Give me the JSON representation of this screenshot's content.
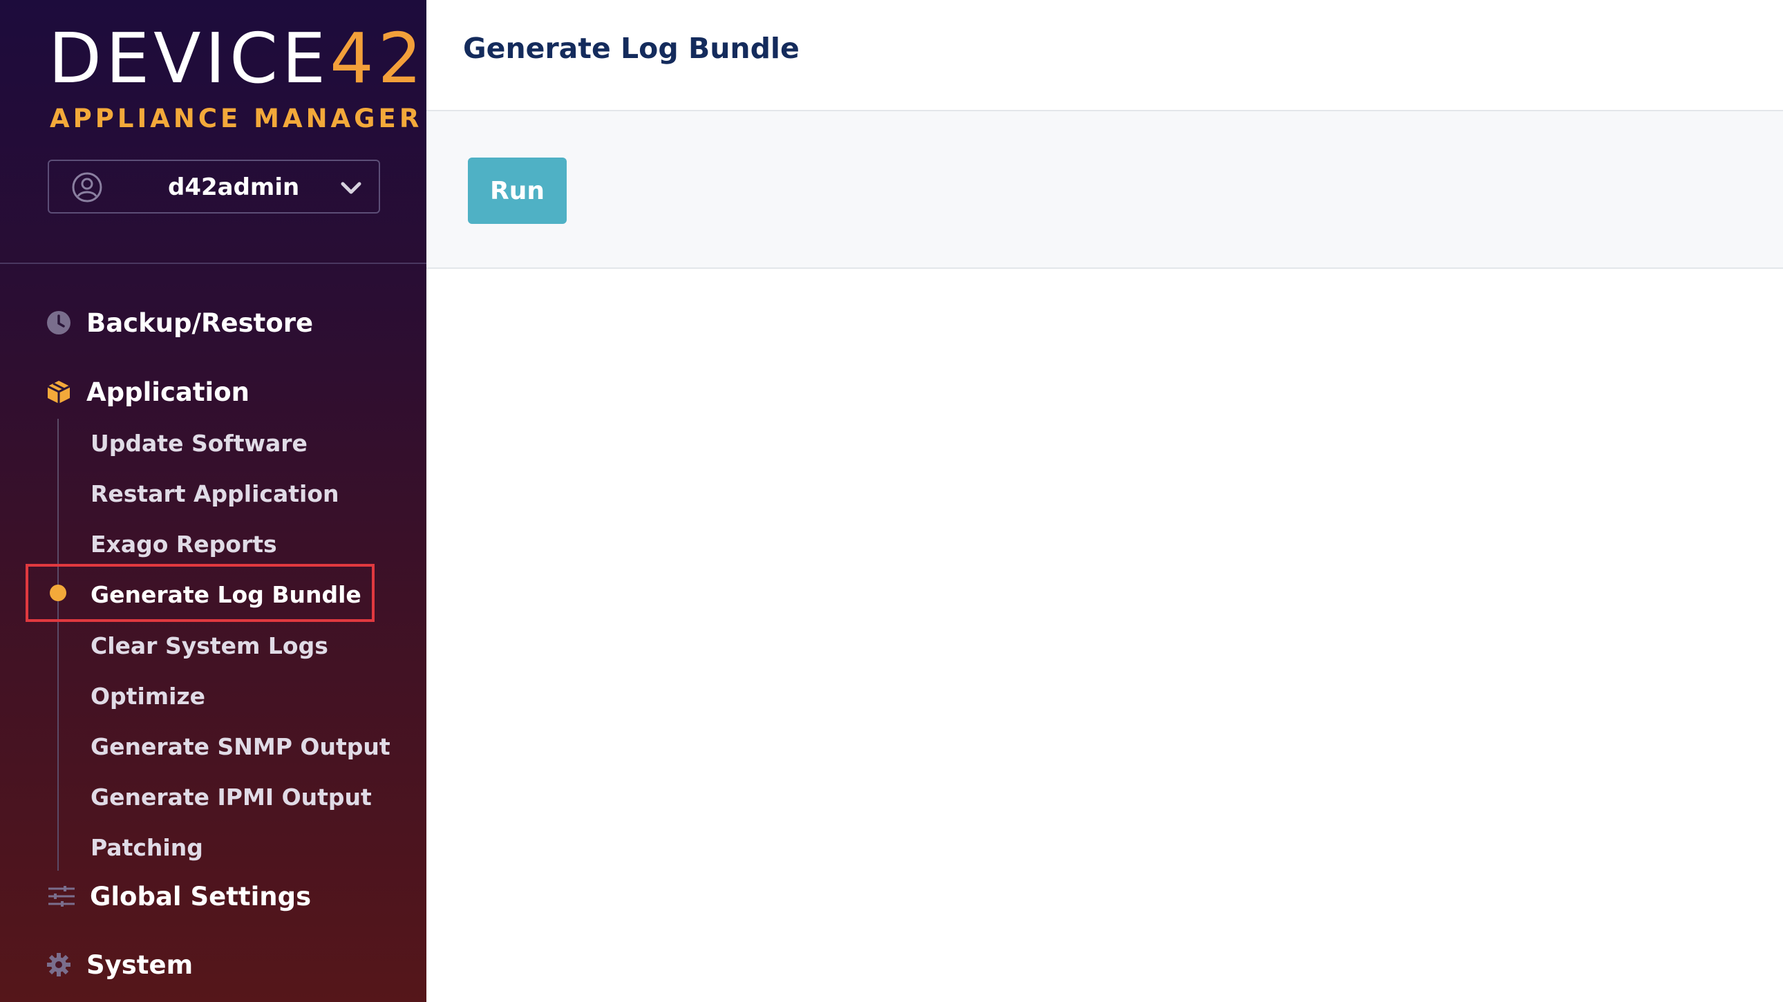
{
  "brand": {
    "logo_left": "DEVICE",
    "logo_right": "42",
    "subtitle": "APPLIANCE MANAGER",
    "accent_color": "#f3a93a"
  },
  "user": {
    "name": "d42admin",
    "icon": "user-circle-icon"
  },
  "sidebar": {
    "sections": [
      {
        "label": "Backup/Restore",
        "icon": "clock-icon"
      },
      {
        "label": "Application",
        "icon": "box-icon"
      },
      {
        "label": "Global Settings",
        "icon": "sliders-icon"
      },
      {
        "label": "System",
        "icon": "gear-icon"
      }
    ],
    "application_items": [
      {
        "label": "Update Software"
      },
      {
        "label": "Restart Application"
      },
      {
        "label": "Exago Reports"
      },
      {
        "label": "Generate Log Bundle",
        "active": true
      },
      {
        "label": "Clear System Logs"
      },
      {
        "label": "Optimize"
      },
      {
        "label": "Generate SNMP Output"
      },
      {
        "label": "Generate IPMI Output"
      },
      {
        "label": "Patching"
      }
    ]
  },
  "main": {
    "title": "Generate Log Bundle",
    "run_label": "Run",
    "button_color": "#4fb1c5",
    "title_color": "#142b5c"
  }
}
